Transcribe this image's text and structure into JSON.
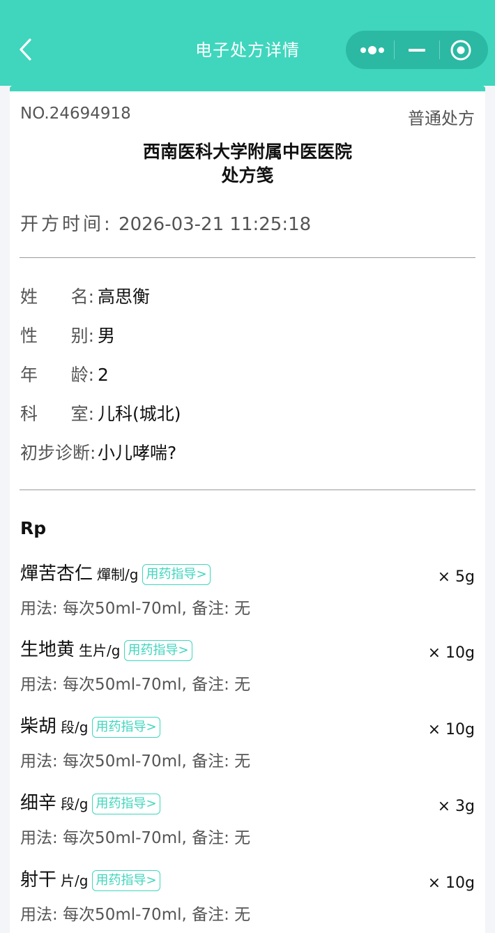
{
  "nav": {
    "title": "电子处方详情"
  },
  "rx": {
    "number": "NO.24694918",
    "type": "普通处方",
    "hospital": "西南医科大学附属中医医院",
    "doc_title": "处方笺",
    "issue_label": "开方时间:",
    "issue_time": "2026-03-21 11:25:18"
  },
  "patient": {
    "name_label": "姓      名:",
    "name": "高思衡",
    "gender_label": "性      别:",
    "gender": "男",
    "age_label": "年      龄:",
    "age": "2",
    "dept_label": "科      室:",
    "dept": "儿科(城北)",
    "diag_label": "初步诊断:",
    "diagnosis": "小儿哮喘?"
  },
  "rp_label": "Rp",
  "guide_label": "用药指导>",
  "drugs": [
    {
      "name": "燀苦杏仁",
      "spec": "燀制/g",
      "qty": "× 5g",
      "usage": "用法: 每次50ml-70ml, 备注: 无"
    },
    {
      "name": "生地黄",
      "spec": "生片/g",
      "qty": "× 10g",
      "usage": "用法: 每次50ml-70ml, 备注: 无"
    },
    {
      "name": "柴胡",
      "spec": "段/g",
      "qty": "× 10g",
      "usage": "用法: 每次50ml-70ml, 备注: 无"
    },
    {
      "name": "细辛",
      "spec": "段/g",
      "qty": "× 3g",
      "usage": "用法: 每次50ml-70ml, 备注: 无"
    },
    {
      "name": "射干",
      "spec": "片/g",
      "qty": "× 10g",
      "usage": "用法: 每次50ml-70ml, 备注: 无"
    }
  ],
  "colors": {
    "accent": "#3fd6bd",
    "text_primary": "#111111",
    "text_secondary": "#555555"
  }
}
